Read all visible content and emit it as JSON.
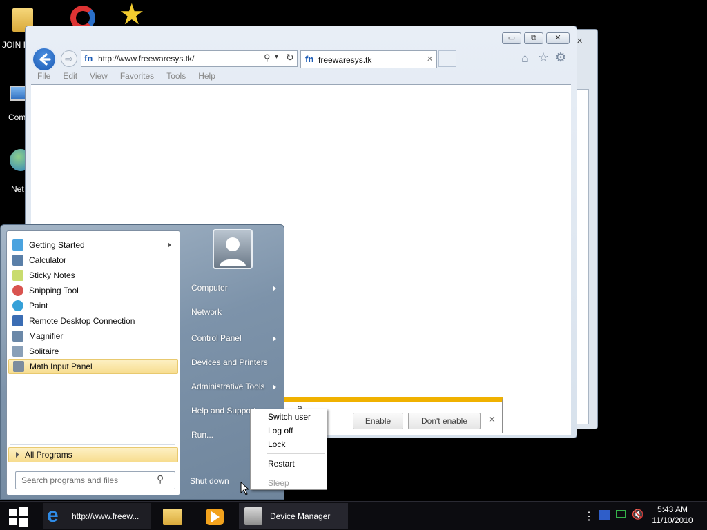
{
  "desktop": {
    "icons": [
      {
        "name": "folder-icon",
        "label": "JOIN IS"
      },
      {
        "name": "ccleaner-icon",
        "label": ""
      },
      {
        "name": "star-icon",
        "label": ""
      },
      {
        "name": "computer-icon",
        "label": "Comp"
      },
      {
        "name": "network-icon",
        "label": "Net"
      }
    ]
  },
  "browser": {
    "address": "http://www.freewaresys.tk/",
    "tab_title": "freewaresys.tk",
    "tab_close": "✕",
    "menu": [
      "File",
      "Edit",
      "View",
      "Favorites",
      "Tools",
      "Help"
    ],
    "window_buttons": {
      "minimize": "▭",
      "maximize": "⧉",
      "close": "✕"
    },
    "back_win_close": "✕"
  },
  "notification": {
    "enable_label": "Enable",
    "dont_enable_label": "Don't enable",
    "close": "✕",
    "partial_text": "a"
  },
  "start_menu": {
    "programs": [
      {
        "label": "Getting Started",
        "has_submenu": true,
        "color": "#4aa3df"
      },
      {
        "label": "Calculator",
        "has_submenu": false,
        "color": "#5a7fa8"
      },
      {
        "label": "Sticky Notes",
        "has_submenu": false,
        "color": "#c9dc6e"
      },
      {
        "label": "Snipping Tool",
        "has_submenu": false,
        "color": "#d9534f"
      },
      {
        "label": "Paint",
        "has_submenu": false,
        "color": "#35a0d8"
      },
      {
        "label": "Remote Desktop Connection",
        "has_submenu": false,
        "color": "#3b6db4"
      },
      {
        "label": "Magnifier",
        "has_submenu": false,
        "color": "#6b88a8"
      },
      {
        "label": "Solitaire",
        "has_submenu": false,
        "color": "#8aa0b8"
      },
      {
        "label": "Math Input Panel",
        "has_submenu": false,
        "color": "#7d8d9e",
        "selected": true
      }
    ],
    "all_programs": "All Programs",
    "search_placeholder": "Search programs and files",
    "right_items": [
      {
        "label": "Computer",
        "has_submenu": true
      },
      {
        "label": "Network",
        "has_submenu": false
      },
      {
        "label": "Control Panel",
        "has_submenu": true
      },
      {
        "label": "Devices and Printers",
        "has_submenu": false
      },
      {
        "label": "Administrative Tools",
        "has_submenu": true
      },
      {
        "label": "Help and Support",
        "has_submenu": false
      },
      {
        "label": "Run...",
        "has_submenu": false
      }
    ],
    "shutdown_label": "Shut down"
  },
  "power_menu": {
    "items": [
      "Switch user",
      "Log off",
      "Lock",
      "Restart",
      "Sleep"
    ]
  },
  "taskbar": {
    "ie_label": "http://www.freew...",
    "device_manager_label": "Device Manager",
    "time": "5:43 AM",
    "date": "11/10/2010",
    "overflow": "⋮"
  }
}
